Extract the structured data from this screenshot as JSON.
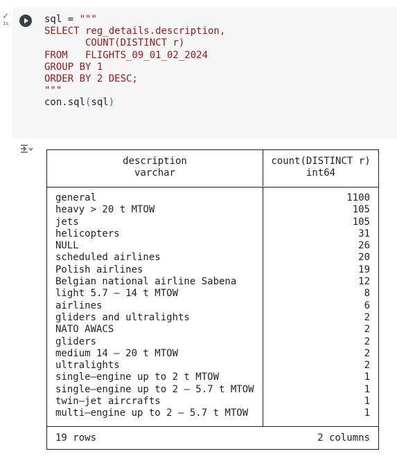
{
  "cell": {
    "status_time": "1s",
    "code_lines": [
      {
        "parts": [
          {
            "t": "sql = ",
            "c": "tok-fn"
          },
          {
            "t": "\"\"\"",
            "c": "tok-str"
          }
        ]
      },
      {
        "parts": [
          {
            "t": "SELECT reg_details.description,",
            "c": "tok-str"
          }
        ]
      },
      {
        "parts": [
          {
            "t": "       COUNT(DISTINCT r)",
            "c": "tok-str"
          }
        ]
      },
      {
        "parts": [
          {
            "t": "FROM   FLIGHTS_09_01_02_2024",
            "c": "tok-str"
          }
        ]
      },
      {
        "parts": [
          {
            "t": "GROUP BY 1",
            "c": "tok-str"
          }
        ]
      },
      {
        "parts": [
          {
            "t": "ORDER BY 2 DESC;",
            "c": "tok-str"
          }
        ]
      },
      {
        "parts": [
          {
            "t": "\"\"\"",
            "c": "tok-str"
          }
        ]
      },
      {
        "parts": [
          {
            "t": "con.sql",
            "c": "tok-fn"
          },
          {
            "t": "(",
            "c": "tok-paren"
          },
          {
            "t": "sql",
            "c": "tok-fn"
          },
          {
            "t": ")",
            "c": "tok-paren"
          }
        ]
      }
    ]
  },
  "table": {
    "col1_name": "description",
    "col1_type": "varchar",
    "col2_name": "count(DISTINCT r)",
    "col2_type": "int64",
    "rows": [
      {
        "description": "general",
        "count": "1100"
      },
      {
        "description": "heavy > 20 t MTOW",
        "count": "105"
      },
      {
        "description": "jets",
        "count": "105"
      },
      {
        "description": "helicopters",
        "count": "31"
      },
      {
        "description": "NULL",
        "count": "26"
      },
      {
        "description": "scheduled airlines",
        "count": "20"
      },
      {
        "description": "Polish airlines",
        "count": "19"
      },
      {
        "description": "Belgian national airline Sabena",
        "count": "12"
      },
      {
        "description": "light 5.7 – 14 t MTOW",
        "count": "8"
      },
      {
        "description": "airlines",
        "count": "6"
      },
      {
        "description": "gliders and ultralights",
        "count": "2"
      },
      {
        "description": "NATO AWACS",
        "count": "2"
      },
      {
        "description": "gliders",
        "count": "2"
      },
      {
        "description": "medium 14 – 20 t MTOW",
        "count": "2"
      },
      {
        "description": "ultralights",
        "count": "2"
      },
      {
        "description": "single–engine up to 2 t MTOW",
        "count": "1"
      },
      {
        "description": "single–engine up to 2 – 5.7 t MTOW",
        "count": "1"
      },
      {
        "description": "twin–jet aircrafts",
        "count": "1"
      },
      {
        "description": "multi–engine up to 2 – 5.7 t MTOW",
        "count": "1"
      }
    ],
    "footer_rows": "19 rows",
    "footer_cols": "2 columns"
  },
  "icons": {
    "status": "check-icon",
    "run": "play-circle-icon",
    "output": "output-collapse-icon"
  }
}
